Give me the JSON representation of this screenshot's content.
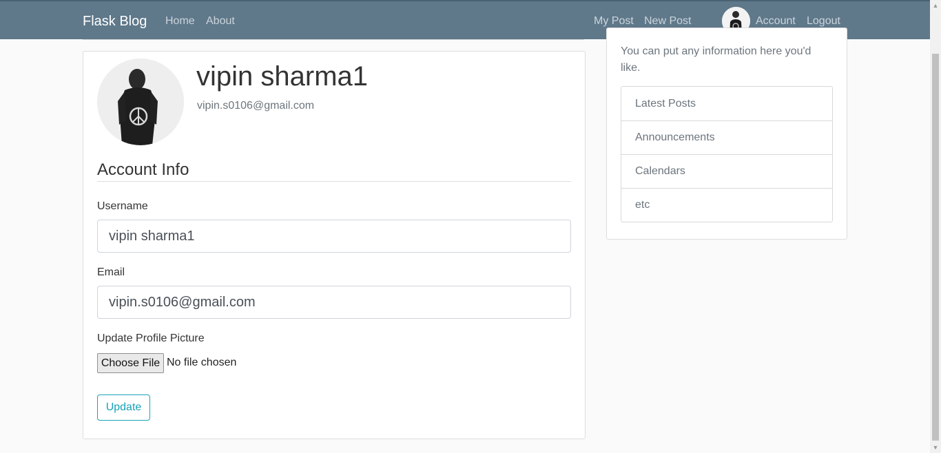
{
  "navbar": {
    "brand": "Flask Blog",
    "left_links": [
      "Home",
      "About"
    ],
    "right_links": [
      "My Post",
      "New Post"
    ],
    "account": "Account",
    "logout": "Logout",
    "bg_color": "#5f788a"
  },
  "profile": {
    "name": "vipin sharma1",
    "email": "vipin.s0106@gmail.com"
  },
  "form": {
    "legend": "Account Info",
    "username_label": "Username",
    "username_value": "vipin sharma1",
    "email_label": "Email",
    "email_value": "vipin.s0106@gmail.com",
    "picture_label": "Update Profile Picture",
    "choose_file": "Choose File",
    "file_status": "No file chosen",
    "submit": "Update"
  },
  "sidebar": {
    "text": "You can put any information here you'd like.",
    "items": [
      "Latest Posts",
      "Announcements",
      "Calendars",
      "etc"
    ]
  },
  "colors": {
    "accent": "#17a2b8",
    "muted": "#6c757d"
  }
}
